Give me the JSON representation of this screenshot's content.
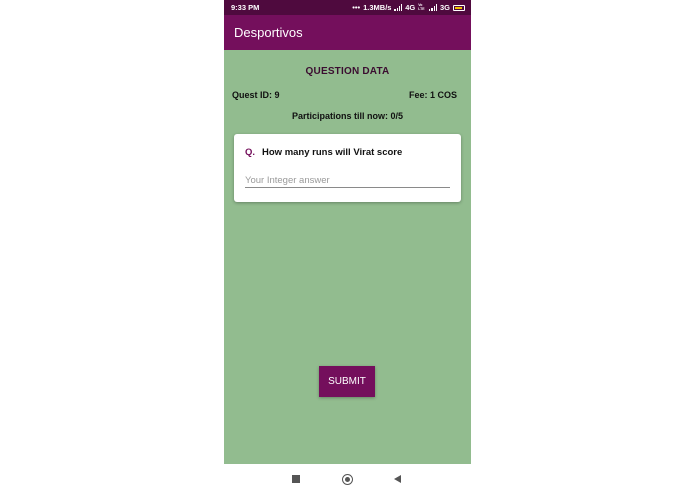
{
  "status_bar": {
    "time": "9:33 PM",
    "speed": "1.3MB/s",
    "network1": "4G",
    "network1_sub": "Vo LTE",
    "network2": "3G",
    "icons": [
      "signal-icon",
      "signal-icon",
      "battery-icon"
    ]
  },
  "app_bar": {
    "title": "Desportivos"
  },
  "question_data": {
    "heading": "QUESTION DATA",
    "quest_id": "Quest ID: 9",
    "fee": "Fee: 1 COS",
    "participations": "Participations till now: 0/5"
  },
  "question_card": {
    "prefix": "Q.",
    "question": "How many runs will Virat score",
    "answer_value": "",
    "answer_placeholder": "Your Integer answer"
  },
  "actions": {
    "submit_label": "SUBMIT"
  },
  "nav_bar": {
    "icons": [
      "recents-icon",
      "home-icon",
      "back-icon"
    ]
  },
  "colors": {
    "status_bar": "#4f0a3e",
    "app_bar": "#740f5c",
    "content_background": "#92bc8f",
    "accent": "#740f5c",
    "battery": "#f2c500"
  }
}
